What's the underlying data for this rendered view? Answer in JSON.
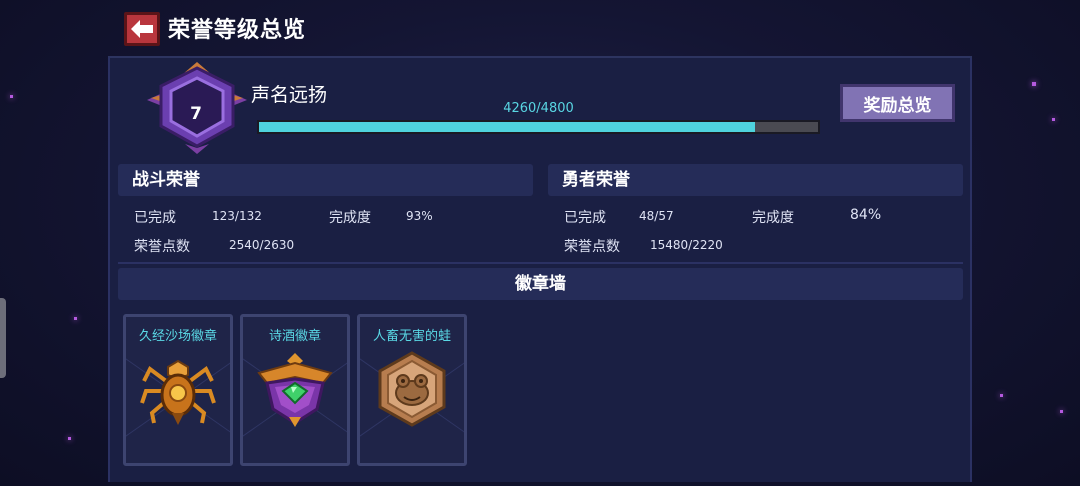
{
  "header": {
    "title": "荣誉等级总览"
  },
  "rank": {
    "level": "7",
    "title": "声名远扬",
    "progress_text": "4260/4800",
    "progress_fraction": 0.8875
  },
  "reward_button": {
    "label": "奖励总览"
  },
  "battle_honor": {
    "title": "战斗荣誉",
    "completed_label": "已完成",
    "completed_value": "123/132",
    "completion_label": "完成度",
    "completion_value": "93%",
    "points_label": "荣誉点数",
    "points_value": "2540/2630"
  },
  "hero_honor": {
    "title": "勇者荣誉",
    "completed_label": "已完成",
    "completed_value": "48/57",
    "completion_label": "完成度",
    "completion_value": "84%",
    "points_label": "荣誉点数",
    "points_value": "15480/2220"
  },
  "badge_wall": {
    "title": "徽章墙",
    "badges": [
      {
        "name": "久经沙场徽章",
        "icon": "spider-badge-icon"
      },
      {
        "name": "诗酒徽章",
        "icon": "emerald-crest-badge-icon"
      },
      {
        "name": "人畜无害的蛙",
        "icon": "frog-hexagon-badge-icon"
      }
    ]
  },
  "colors": {
    "accent": "#4fd3dd",
    "back_button": "#b9363d",
    "reward_button": "#8173b4",
    "badge_name": "#5ad8e5"
  }
}
